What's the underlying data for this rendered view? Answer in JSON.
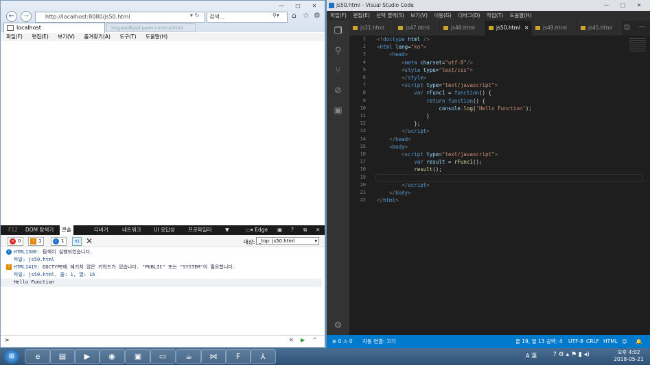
{
  "ie": {
    "address": "http://localhost:8080/js50.html",
    "search_placeholder": "검색...",
    "tab_title": "localhost",
    "tab2": "lmgasdfkjsd:pwer.com/uchtml",
    "menu": [
      "파일(F)",
      "편집(E)",
      "보기(V)",
      "즐겨찾기(A)",
      "도구(T)",
      "도움말(H)"
    ]
  },
  "devtools": {
    "tabs": [
      "F12",
      "DOM 탐색기",
      "콘솔",
      "디버거",
      "네트워크",
      "UI 응답성",
      "프로파일러",
      "Edge"
    ],
    "counts": {
      "errors": "0",
      "warnings": "1",
      "info": "1"
    },
    "target_label": "대상:",
    "target_value": "_top: js50.html",
    "messages": [
      {
        "code": "HTML1300:",
        "text": "탐색이 실행되었습니다.",
        "file": "파일: js50.html",
        "type": "info"
      },
      {
        "code": "HTML1419:",
        "text": "DOCTYPE에 예기치 않은 키워드가 있습니다. \"PUBLIC\" 또는 \"SYSTEM\"이 필요합니다.",
        "file": "파일: js50.html, 줄: 1, 열: 16",
        "type": "warning"
      },
      {
        "text": "Hello Function",
        "type": "log"
      }
    ],
    "prompt": ">"
  },
  "vscode": {
    "title": "js50.html - Visual Studio Code",
    "menu": [
      "파일(F)",
      "편집(E)",
      "선택 영역(S)",
      "보기(V)",
      "이동(G)",
      "디버그(D)",
      "작업(T)",
      "도움말(H)"
    ],
    "tabs": [
      "js31.html",
      "js47.html",
      "js48.html",
      "js50.html",
      "js49.html",
      "js45.html"
    ],
    "active_tab": "js50.html",
    "status": {
      "left": "⊗ 0 ⚠ 0",
      "connect": "자동 연결: 끄기",
      "position": "줄 19, 열 13",
      "spaces": "공백: 4",
      "encoding": "UTF-8",
      "eol": "CRLF",
      "lang": "HTML"
    }
  },
  "taskbar": {
    "time": "오후 4:02",
    "date": "2018-05-21",
    "lang": "A 漢"
  }
}
